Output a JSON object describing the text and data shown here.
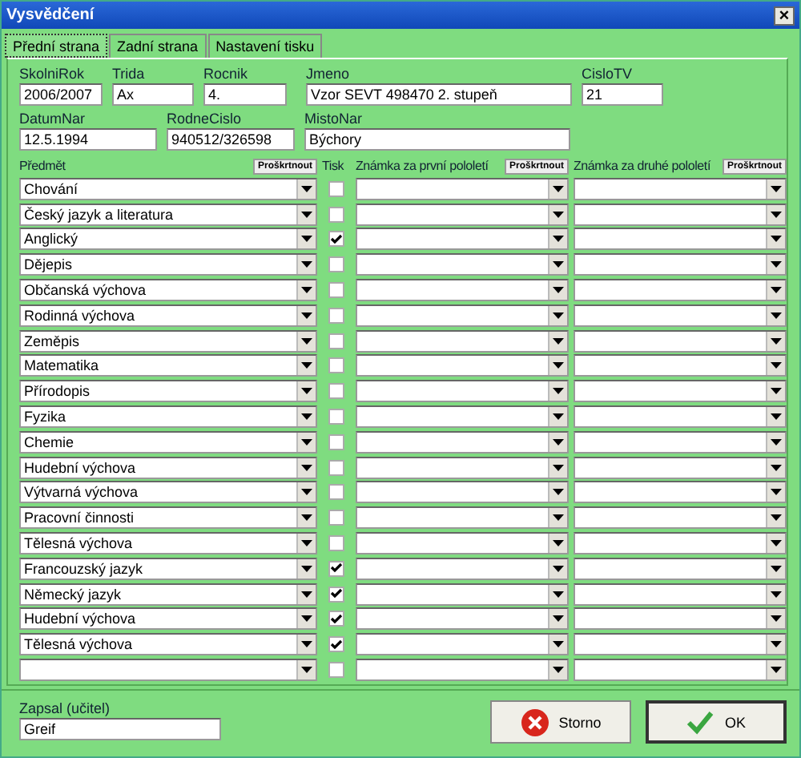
{
  "window": {
    "title": "Vysvědčení",
    "close": "×"
  },
  "tabs": [
    {
      "label": "Přední strana",
      "selected": true
    },
    {
      "label": "Zadní strana",
      "selected": false
    },
    {
      "label": "Nastavení tisku",
      "selected": false
    }
  ],
  "fields_row_1": [
    {
      "label": "SkolniRok",
      "value": "2006/2007"
    },
    {
      "label": "Trida",
      "value": "Ax"
    },
    {
      "label": "Rocnik",
      "value": "4."
    },
    {
      "label": "Jmeno",
      "value": "Vzor SEVT 498470 2. stupeň"
    },
    {
      "label": "CisloTV",
      "value": "21"
    }
  ],
  "fields_row_2": [
    {
      "label": "DatumNar",
      "value": "12.5.1994"
    },
    {
      "label": "RodneCislo",
      "value": "940512/326598"
    },
    {
      "label": "MistoNar",
      "value": "Býchory"
    }
  ],
  "grades_table": {
    "columns": [
      {
        "label": "Předmět",
        "button": "Proškrtnout"
      },
      {
        "label": "Tisk"
      },
      {
        "label": "Známka za první pololetí",
        "button": "Proškrtnout"
      },
      {
        "label": "Známka za druhé pololetí",
        "button": "Proškrtnout"
      }
    ],
    "rows": [
      {
        "subject": "Chování",
        "print": false
      },
      {
        "subject": "Český jazyk a literatura",
        "print": false
      },
      {
        "subject": "Anglický",
        "print": true
      },
      {
        "subject": "Dějepis",
        "print": false
      },
      {
        "subject": "Občanská výchova",
        "print": false
      },
      {
        "subject": "Rodinná výchova",
        "print": false
      },
      {
        "subject": "Zeměpis",
        "print": false
      },
      {
        "subject": "Matematika",
        "print": false
      },
      {
        "subject": "Přírodopis",
        "print": false
      },
      {
        "subject": "Fyzika",
        "print": false
      },
      {
        "subject": "Chemie",
        "print": false
      },
      {
        "subject": "Hudební výchova",
        "print": false
      },
      {
        "subject": "Výtvarná výchova",
        "print": false
      },
      {
        "subject": "Pracovní činnosti",
        "print": false
      },
      {
        "subject": "Tělesná výchova",
        "print": false
      },
      {
        "subject": "Francouzský jazyk",
        "print": true
      },
      {
        "subject": "Německý jazyk",
        "print": true
      },
      {
        "subject": "Hudební výchova",
        "print": true
      },
      {
        "subject": "Tělesná výchova",
        "print": true
      },
      {
        "print": false
      }
    ]
  },
  "recorded_by": {
    "label": "Zapsal (učitel)",
    "value": "Greif"
  },
  "buttons": [
    {
      "label": "Storno",
      "kind": "cancel"
    },
    {
      "label": "OK",
      "kind": "ok"
    }
  ]
}
